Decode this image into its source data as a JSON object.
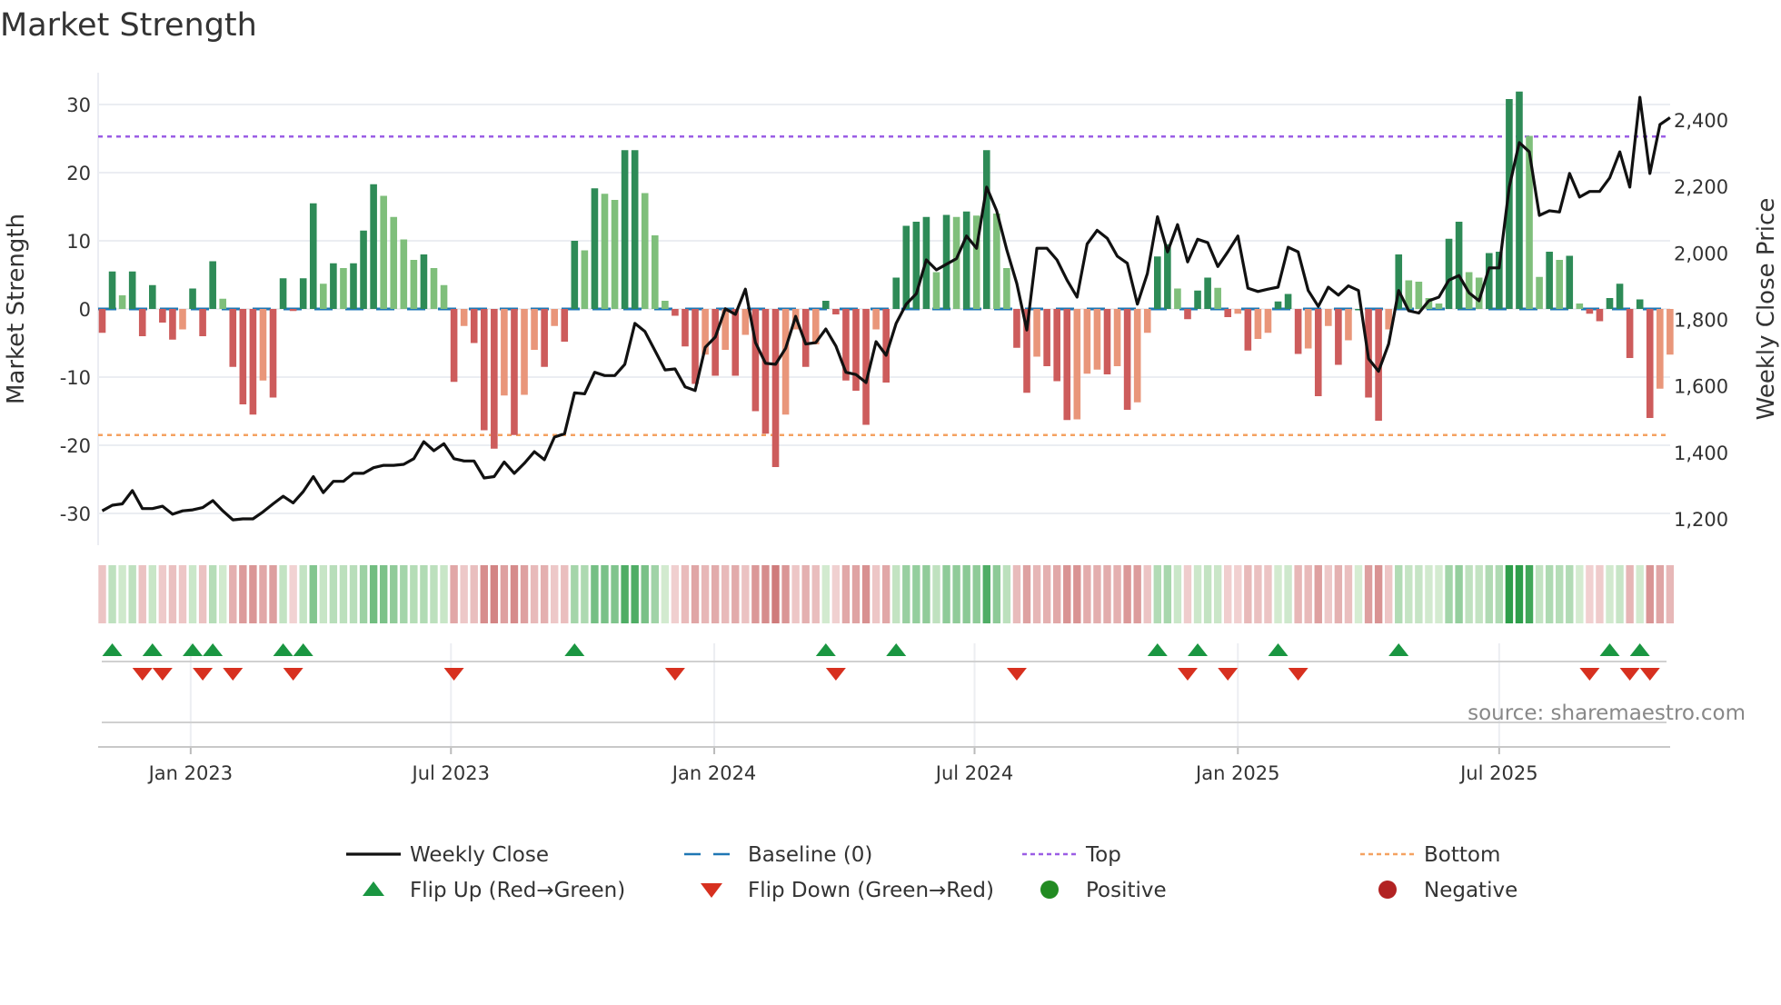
{
  "chart_data": {
    "type": "bar",
    "title": "Market Strength",
    "ylabel": "Market Strength",
    "ylabel_right": "Weekly Close Price",
    "ylim": [
      -34,
      35
    ],
    "ylim_right": [
      1120,
      2550
    ],
    "yticks": [
      -30,
      -20,
      -10,
      0,
      10,
      20,
      30
    ],
    "yticks_right": [
      1200,
      1400,
      1600,
      1800,
      2000,
      2200,
      2400
    ],
    "yticks_right_labels": [
      "1,200",
      "1,400",
      "1,600",
      "1,800",
      "2,000",
      "2,200",
      "2,400"
    ],
    "x_unit": "week index",
    "xticks": [
      {
        "week": 8.8,
        "label": "Jan 2023"
      },
      {
        "week": 34.7,
        "label": "Jul 2023"
      },
      {
        "week": 60.9,
        "label": "Jan 2024"
      },
      {
        "week": 86.8,
        "label": "Jul 2024"
      },
      {
        "week": 113.0,
        "label": "Jan 2025"
      },
      {
        "week": 139.0,
        "label": "Jul 2025"
      }
    ],
    "top_level": 25.3,
    "bottom_level": -18.5,
    "baseline": 0,
    "strength": [
      -3.5,
      5.5,
      2,
      5.5,
      -4,
      3.5,
      -2,
      -4.5,
      -3,
      3,
      -4,
      7,
      1.5,
      -8.5,
      -14,
      -15.5,
      -10.5,
      -13,
      4.5,
      -0.3,
      4.5,
      15.5,
      3.7,
      6.7,
      6,
      6.7,
      11.5,
      18.3,
      16.6,
      13.5,
      10.2,
      7.2,
      8,
      6,
      3.5,
      -10.7,
      -2.5,
      -5,
      -17.8,
      -20.5,
      -12.7,
      -18.5,
      -12.6,
      -6,
      -8.5,
      -2.5,
      -4.8,
      10,
      8.6,
      17.7,
      16.9,
      16,
      23.3,
      23.3,
      17,
      10.8,
      1.2,
      -1,
      -5.5,
      -11,
      -6.7,
      -9.8,
      -6,
      -9.8,
      -3.8,
      -15,
      -18.3,
      -23.2,
      -15.5,
      -3,
      -8.5,
      -5.2,
      1.2,
      -0.8,
      -10.5,
      -12,
      -17,
      -3,
      -10.8,
      4.6,
      12.2,
      12.8,
      13.5,
      5.4,
      13.8,
      13.5,
      14.3,
      13.7,
      23.3,
      14,
      6,
      -5.7,
      -12.3,
      -7,
      -8.4,
      -10.6,
      -16.3,
      -16.2,
      -9.5,
      -8.9,
      -9.6,
      -8.4,
      -14.8,
      -13.7,
      -3.5,
      7.7,
      9.5,
      3,
      -1.5,
      2.7,
      4.6,
      3.1,
      -1.2,
      -0.7,
      -6.1,
      -4.4,
      -3.5,
      1.1,
      2.2,
      -6.6,
      -5.8,
      -12.8,
      -2.5,
      -8.2,
      -4.6,
      0,
      -13,
      -16.4,
      -3,
      8,
      4.2,
      4,
      1.6,
      0.8,
      10.3,
      12.8,
      5.4,
      4.6,
      8.2,
      8.4,
      30.8,
      31.9,
      25.4,
      4.7,
      8.4,
      7.2,
      7.8,
      0.8,
      -0.7,
      -1.8,
      1.6,
      3.7,
      -7.2,
      1.4,
      -16,
      -11.7,
      -6.7
    ],
    "weekly_close": [
      1224,
      1241,
      1245,
      1285,
      1231,
      1231,
      1238,
      1214,
      1224,
      1227,
      1234,
      1255,
      1224,
      1197,
      1200,
      1200,
      1221,
      1245,
      1268,
      1248,
      1282,
      1327,
      1279,
      1313,
      1313,
      1337,
      1337,
      1354,
      1361,
      1361,
      1364,
      1381,
      1432,
      1405,
      1426,
      1381,
      1374,
      1374,
      1323,
      1327,
      1371,
      1337,
      1367,
      1402,
      1378,
      1446,
      1456,
      1579,
      1576,
      1641,
      1631,
      1631,
      1665,
      1788,
      1764,
      1706,
      1648,
      1651,
      1597,
      1586,
      1716,
      1747,
      1832,
      1815,
      1891,
      1730,
      1668,
      1665,
      1713,
      1809,
      1726,
      1730,
      1771,
      1720,
      1641,
      1634,
      1610,
      1733,
      1692,
      1788,
      1846,
      1877,
      1979,
      1949,
      1966,
      1983,
      2051,
      2014,
      2198,
      2127,
      2010,
      1908,
      1768,
      2014,
      2014,
      1979,
      1918,
      1867,
      2027,
      2068,
      2044,
      1990,
      1969,
      1846,
      1938,
      2109,
      2003,
      2085,
      1973,
      2041,
      2031,
      1959,
      2003,
      2051,
      1894,
      1884,
      1891,
      1897,
      2017,
      2003,
      1887,
      1839,
      1897,
      1873,
      1901,
      1887,
      1682,
      1644,
      1726,
      1887,
      1826,
      1819,
      1856,
      1867,
      1918,
      1932,
      1880,
      1856,
      1955,
      1955,
      2198,
      2332,
      2304,
      2113,
      2127,
      2123,
      2239,
      2168,
      2185,
      2185,
      2226,
      2304,
      2198,
      2468,
      2239,
      2386,
      2407
    ],
    "flip_up_weeks": [
      1,
      5,
      9,
      11,
      18,
      20,
      47,
      72,
      79,
      105,
      109,
      117,
      129,
      150,
      153
    ],
    "flip_down_weeks": [
      4,
      6,
      10,
      13,
      19,
      35,
      57,
      73,
      91,
      108,
      112,
      119,
      148,
      152,
      154
    ],
    "legend": [
      {
        "key": "weekly_close",
        "label": "Weekly Close"
      },
      {
        "key": "baseline",
        "label": "Baseline (0)"
      },
      {
        "key": "top",
        "label": "Top"
      },
      {
        "key": "bottom",
        "label": "Bottom"
      },
      {
        "key": "flip_up",
        "label": "Flip Up (Red→Green)"
      },
      {
        "key": "flip_down",
        "label": "Flip Down (Green→Red)"
      },
      {
        "key": "positive",
        "label": "Positive"
      },
      {
        "key": "negative",
        "label": "Negative"
      }
    ],
    "legend_placement": "bottom-center",
    "grid": true
  },
  "source": "source: sharemaestro.com",
  "colors": {
    "pos_rising": "#2e8b57",
    "pos_falling": "#7fbf7b",
    "neg_falling": "#cd5c5c",
    "neg_rising": "#e9967a",
    "line": "#111111",
    "baseline": "#1f77b4",
    "top": "#9b5de5",
    "bottom": "#f4a261",
    "flip_up": "#1a9641",
    "flip_down": "#d7301f",
    "positive": "#228b22",
    "negative": "#b22222",
    "grid": "#ebedf2"
  }
}
